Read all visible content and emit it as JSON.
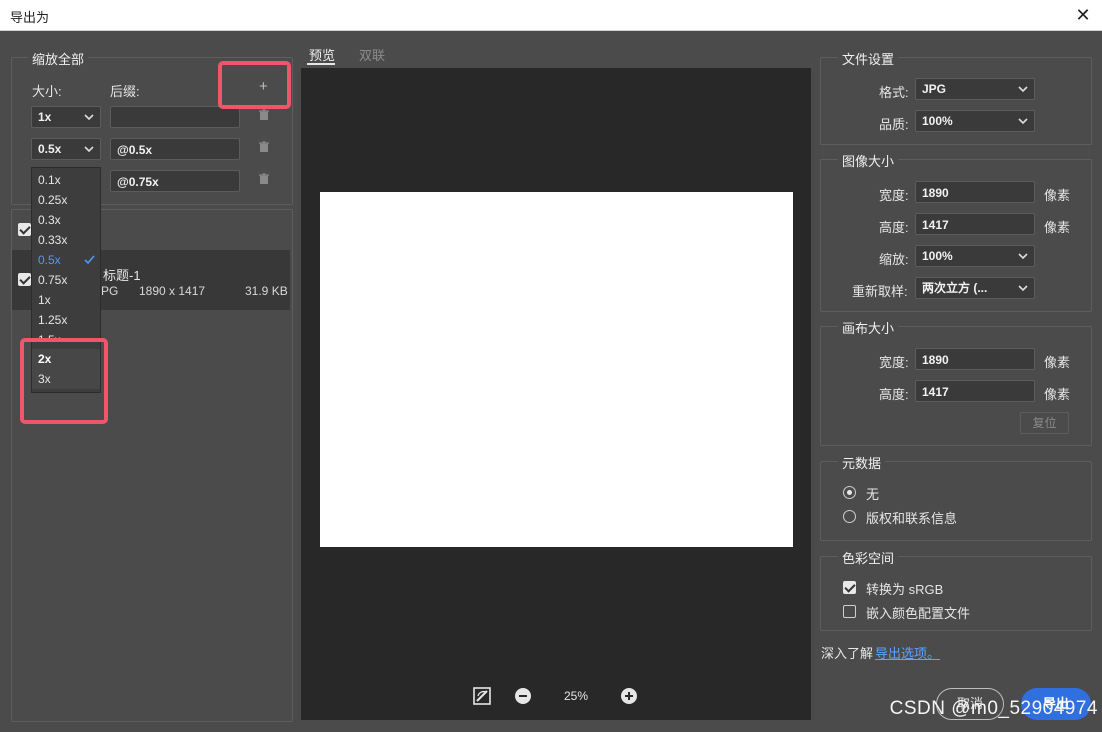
{
  "window": {
    "title": "导出为",
    "close_glyph": "✕"
  },
  "scale_all": {
    "legend": "缩放全部",
    "size_label": "大小:",
    "suffix_label": "后缀:",
    "add_glyph": "+",
    "rows": [
      {
        "size": "1x",
        "suffix": ""
      },
      {
        "size": "0.5x",
        "suffix": "@0.5x"
      },
      {
        "size": "0.75x",
        "suffix": "@0.75x"
      }
    ],
    "dropdown_options": [
      "0.1x",
      "0.25x",
      "0.3x",
      "0.33x",
      "0.5x",
      "0.75x",
      "1x",
      "1.25x",
      "1.5x",
      "2x",
      "3x"
    ],
    "dropdown_selected": "0.5x",
    "dropdown_highlight": "2x"
  },
  "assets": {
    "item_name_partial": "标题-1",
    "item_format_partial": "PG",
    "item_dimensions": "1890 x 1417",
    "item_size": "31.9 KB"
  },
  "preview": {
    "tabs": [
      "预览",
      "双联"
    ],
    "zoom": "25%"
  },
  "file_settings": {
    "legend": "文件设置",
    "format_label": "格式:",
    "format_value": "JPG",
    "quality_label": "品质:",
    "quality_value": "100%"
  },
  "image_size": {
    "legend": "图像大小",
    "width_label": "宽度:",
    "width_value": "1890",
    "height_label": "高度:",
    "height_value": "1417",
    "unit": "像素",
    "scale_label": "缩放:",
    "scale_value": "100%",
    "resample_label": "重新取样:",
    "resample_value": "两次立方 (..."
  },
  "canvas_size": {
    "legend": "画布大小",
    "width_label": "宽度:",
    "width_value": "1890",
    "height_label": "高度:",
    "height_value": "1417",
    "unit": "像素",
    "reset_label": "复位"
  },
  "metadata": {
    "legend": "元数据",
    "options": [
      "无",
      "版权和联系信息"
    ],
    "selected": "无"
  },
  "color_space": {
    "legend": "色彩空间",
    "convert_label": "转换为 sRGB",
    "embed_label": "嵌入颜色配置文件"
  },
  "footer": {
    "learn_more": "深入了解",
    "link_text": "导出选项。",
    "cancel": "取消",
    "export": "导出"
  },
  "watermark": "CSDN @m0_52904974",
  "colors": {
    "accent_blue": "#2f6fe0",
    "highlight_red": "#f0556b",
    "check_blue": "#4b9bff"
  }
}
